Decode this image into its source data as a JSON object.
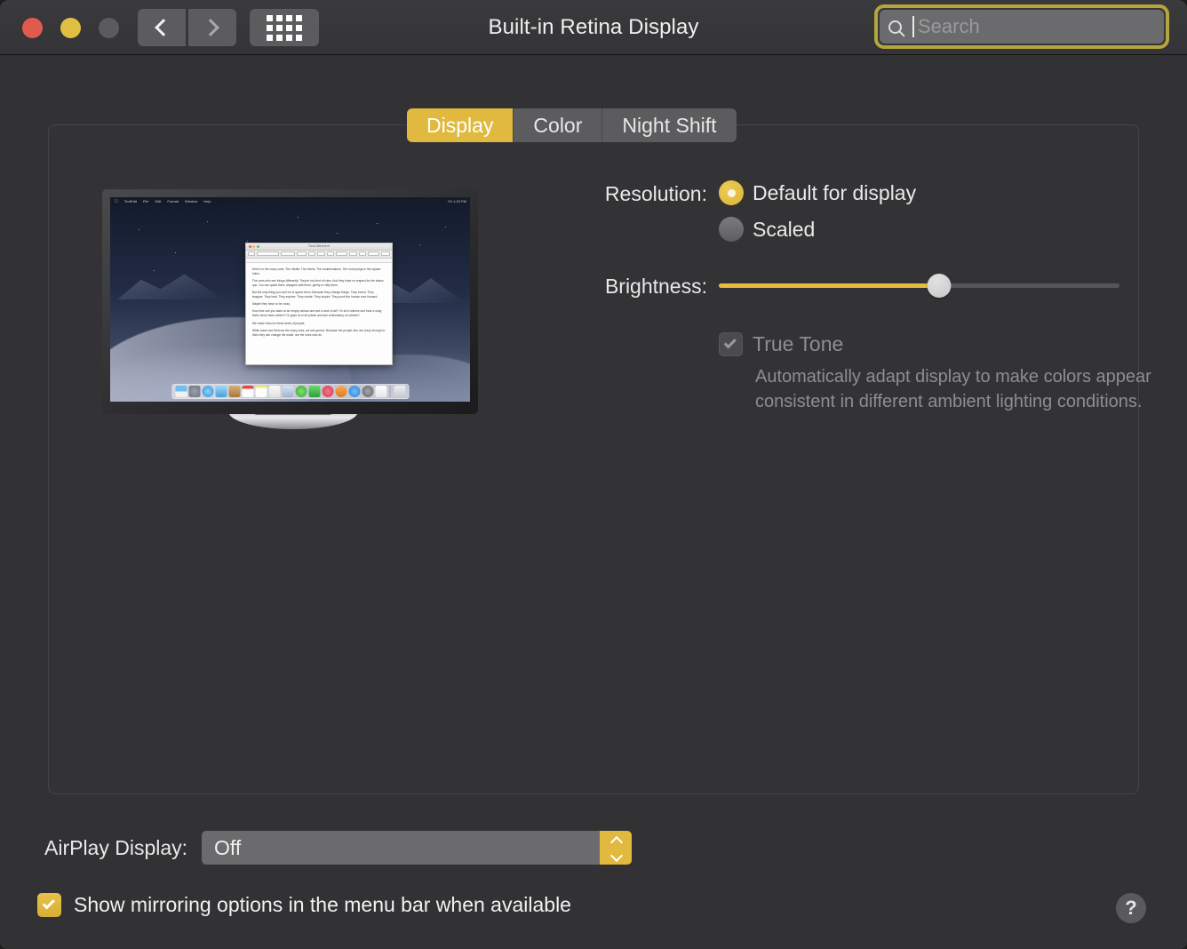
{
  "window": {
    "title": "Built-in Retina Display",
    "accent_color": "#e0b93e",
    "background_color": "#323234"
  },
  "toolbar": {
    "traffic_lights": [
      {
        "name": "close",
        "color": "#e05a4e"
      },
      {
        "name": "minimize",
        "color": "#e0c042"
      },
      {
        "name": "zoom",
        "color": "#5b5b5d"
      }
    ],
    "back_icon": "chevron-left-icon",
    "forward_icon": "chevron-right-icon",
    "grid_icon": "show-all-grid-icon"
  },
  "search": {
    "icon": "search-icon",
    "placeholder": "Search",
    "value": "",
    "focused": true,
    "focus_ring_color": "#b5a53e"
  },
  "tabs": [
    {
      "label": "Display",
      "active": true
    },
    {
      "label": "Color",
      "active": false
    },
    {
      "label": "Night Shift",
      "active": false
    }
  ],
  "settings": {
    "resolution": {
      "label": "Resolution:",
      "options": [
        {
          "label": "Default for display",
          "selected": true
        },
        {
          "label": "Scaled",
          "selected": false
        }
      ]
    },
    "brightness": {
      "label": "Brightness:",
      "value_percent": 55
    },
    "true_tone": {
      "label": "True Tone",
      "checked": true,
      "enabled": false,
      "description": "Automatically adapt display to make colors appear consistent in different ambient lighting conditions."
    }
  },
  "airplay": {
    "label": "AirPlay Display:",
    "value": "Off",
    "options": [
      "Off"
    ],
    "stepper_icon": "stepper-up-down-icon"
  },
  "mirroring": {
    "label": "Show mirroring options in the menu bar when available",
    "checked": true
  },
  "help": {
    "label": "?"
  },
  "preview": {
    "menubar": {
      "apple": "",
      "items": [
        "TextEdit",
        "File",
        "Edit",
        "Format",
        "Window",
        "Help"
      ],
      "status": [
        "Fri 1:23 PM"
      ]
    },
    "textedit": {
      "title": "Think Different.rtf",
      "paragraphs": [
        "Here's to the crazy ones. The misfits. The rebels. The troublemakers. The round pegs in the square holes.",
        "The ones who see things differently. They're not fond of rules. And they have no respect for the status quo. You can quote them, disagree with them, glorify or vilify them.",
        "But the only thing you can't do is ignore them. Because they change things. They invent. They imagine. They heal. They explore. They create. They inspire. They push the human race forward.",
        "Maybe they have to be crazy.",
        "How else can you stare at an empty canvas and see a work of art? Or sit in silence and hear a song that's never been written? Or gaze at a red planet and see a laboratory on wheels?",
        "We make tools for these kinds of people.",
        "While some see them as the crazy ones, we see genius. Because the people who are crazy enough to think they can change the world, are the ones who do."
      ]
    },
    "dock_icons": [
      {
        "name": "finder-icon",
        "color": "#4e9fe0"
      },
      {
        "name": "launchpad-icon",
        "color": "#bfc4cc"
      },
      {
        "name": "safari-icon",
        "color": "#5ab4f0"
      },
      {
        "name": "mail-icon",
        "color": "#6fb8e8"
      },
      {
        "name": "contacts-icon",
        "color": "#c99a5a"
      },
      {
        "name": "calendar-icon",
        "color": "#f0f0f0"
      },
      {
        "name": "notes-icon",
        "color": "#f5e06a"
      },
      {
        "name": "reminders-icon",
        "color": "#f2f2f2"
      },
      {
        "name": "photos-icon",
        "color": "#dfe2e8"
      },
      {
        "name": "messages-icon",
        "color": "#4fc35a"
      },
      {
        "name": "facetime-icon",
        "color": "#48c04e"
      },
      {
        "name": "itunes-icon",
        "color": "#ea4b63"
      },
      {
        "name": "ibooks-icon",
        "color": "#f09840"
      },
      {
        "name": "appstore-icon",
        "color": "#3f9ae8"
      },
      {
        "name": "system-preferences-icon",
        "color": "#8d8d8f"
      },
      {
        "name": "textedit-icon",
        "color": "#f0f0f0"
      },
      {
        "name": "trash-icon",
        "color": "#d8dce2"
      }
    ]
  }
}
